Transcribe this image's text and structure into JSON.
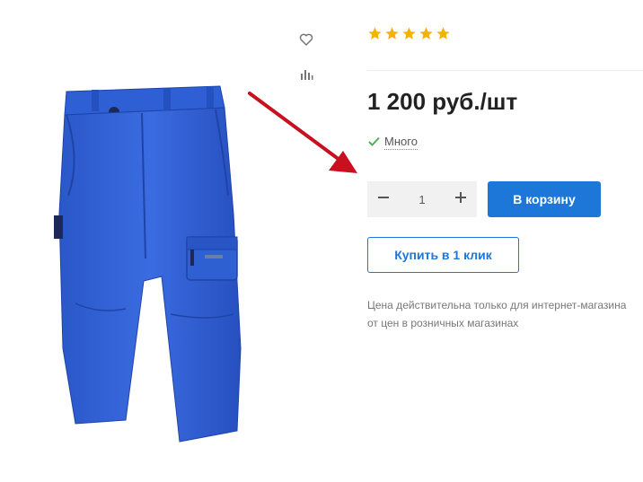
{
  "product": {
    "image_alt": "blue cargo shorts",
    "rating_stars": 5,
    "star_color": "#f5b301",
    "price": "1 200 руб./шт",
    "stock_text": "Много",
    "stock_color": "#4caf50",
    "quantity": "1",
    "add_to_cart_label": "В корзину",
    "buy_one_click_label": "Купить в 1 клик",
    "price_note_line1": "Цена действительна только для интернет-магазина",
    "price_note_line2": "от цен в розничных магазинах"
  },
  "side_icons": [
    "heart-icon",
    "compare-chart-icon"
  ],
  "annotation": {
    "arrow_color": "#c8101e"
  },
  "accent_color": "#1d77d8"
}
